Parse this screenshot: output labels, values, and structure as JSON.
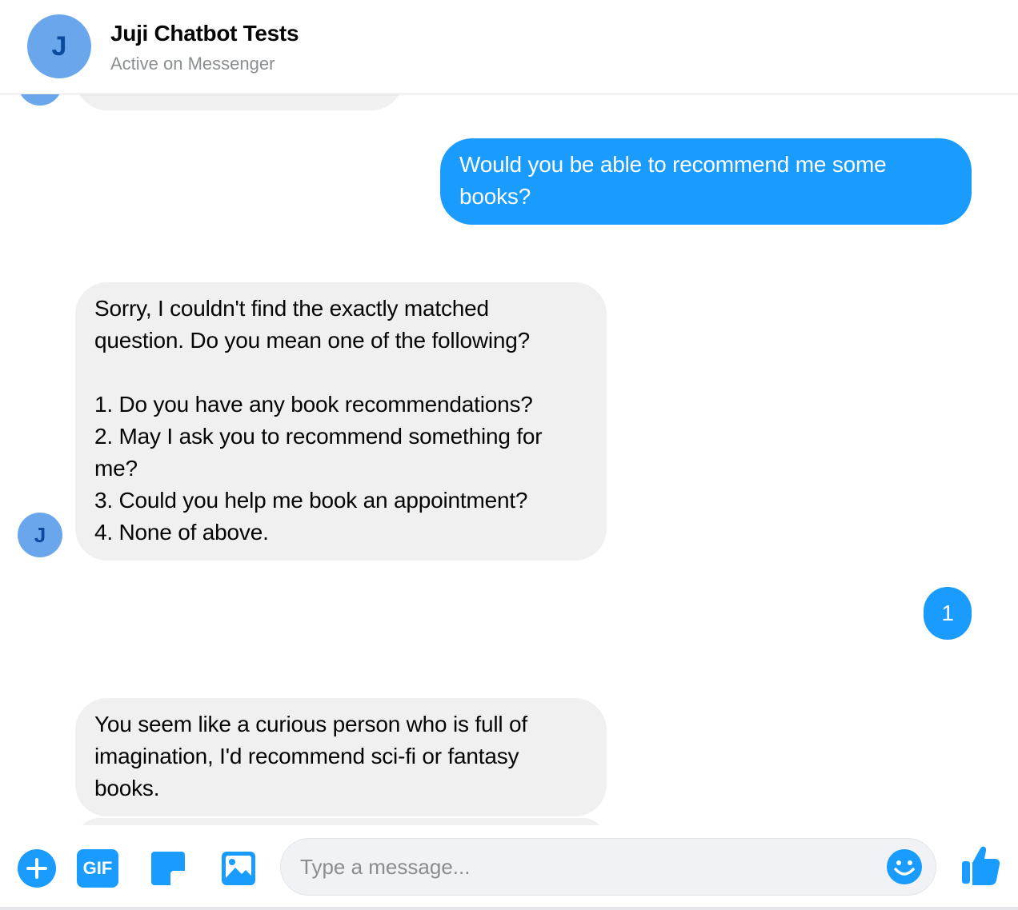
{
  "header": {
    "avatar_initial": "J",
    "title": "Juji Chatbot Tests",
    "subtitle": "Active on Messenger"
  },
  "messages": [
    {
      "from": "bot",
      "text": ""
    },
    {
      "from": "user",
      "text": "Would you be able to recommend me some\nbooks?"
    },
    {
      "from": "bot",
      "text": "Sorry, I couldn't find the exactly matched\nquestion. Do you mean one of the following?\n\n1. Do you have any book recommendations?\n2. May I ask you to recommend something for\nme?\n3. Could you help me book an appointment?\n4. None of above."
    },
    {
      "from": "user",
      "text": "1"
    },
    {
      "from": "bot",
      "text": "You seem like a curious person who is full of\nimagination, I'd recommend sci-fi or fantasy\nbooks."
    }
  ],
  "bot_avatar_initial": "J",
  "composer": {
    "gif_label": "GIF",
    "placeholder": "Type a message..."
  },
  "icons": {
    "add": "plus-circle-icon",
    "gif": "gif-icon",
    "sticker": "sticker-icon",
    "photo": "photo-icon",
    "emoji": "smiley-icon",
    "like": "thumbs-up-icon"
  },
  "colors": {
    "accent": "#1a9cff",
    "bot_bubble": "#f0f0f0",
    "avatar": "#6aa6ec"
  }
}
